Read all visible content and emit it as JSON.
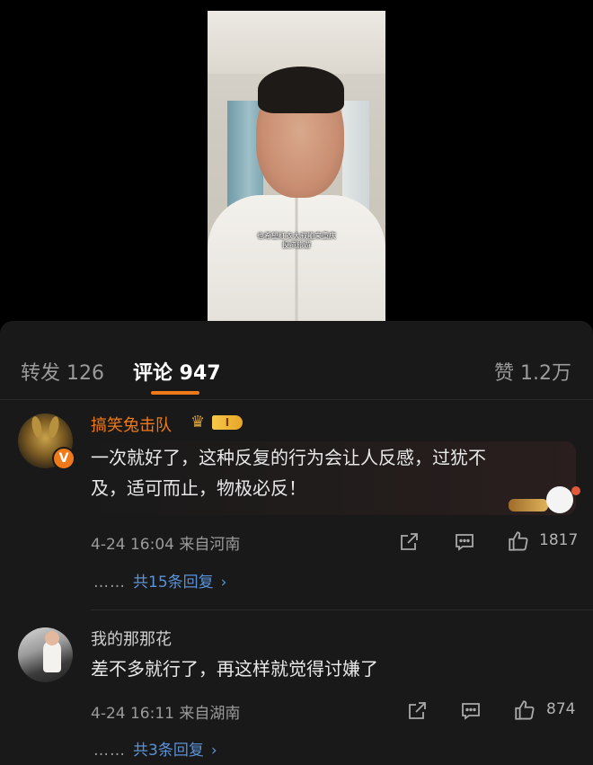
{
  "video": {
    "caption_line1": "也希望红衣大叔能来重庆",
    "caption_line2": "投资旅游"
  },
  "tabs": {
    "forward_label": "转发 126",
    "comments_label": "评论 947",
    "likes_label": "赞 1.2万",
    "active": "comments"
  },
  "comments": [
    {
      "username": "搞笑兔击队",
      "level_badge": "I",
      "text": "一次就好了，这种反复的行为会让人反感，过犹不及，适可而止，物极必反！",
      "text_line1": "一次就好了，这种反复的行为会让人反感，过犹不",
      "text_line2": "及，适可而止，物极必反！",
      "time": "4-24 16:04",
      "location": "来自河南",
      "meta": "4-24 16:04 来自河南",
      "likes": "1817",
      "replies_dots": "……",
      "replies_label": "共15条回复",
      "verified": true
    },
    {
      "username": "我的那那花",
      "text": "差不多就行了，再这样就觉得讨嫌了",
      "time": "4-24 16:11",
      "location": "来自湖南",
      "meta": "4-24 16:11 来自湖南",
      "likes": "874",
      "replies_dots": "……",
      "replies_label": "共3条回复"
    }
  ],
  "icons": {
    "share": "share-icon",
    "comment": "comment-icon",
    "like": "thumbs-up-icon",
    "chevron": "chevron-right-icon",
    "verify_mark": "V"
  },
  "colors": {
    "accent": "#f07a1a",
    "link": "#5a92d8",
    "panel_bg": "#191919"
  }
}
